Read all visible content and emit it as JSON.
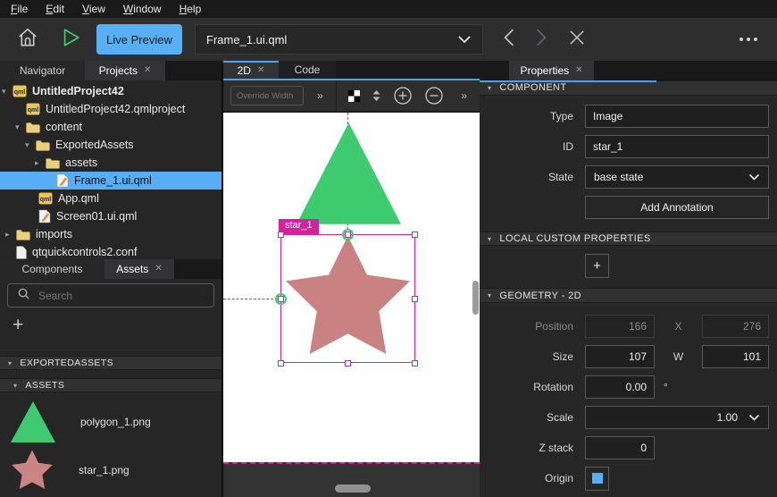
{
  "menubar": {
    "items": [
      "File",
      "Edit",
      "View",
      "Window",
      "Help"
    ]
  },
  "toolbar": {
    "live_preview_label": "Live Preview",
    "open_file": "Frame_1.ui.qml"
  },
  "left_panel": {
    "tabs_top": {
      "navigator": "Navigator",
      "projects": "Projects"
    },
    "project_tree": [
      "UntitledProject42",
      "UntitledProject42.qmlproject",
      "content",
      "ExportedAssets",
      "assets",
      "Frame_1.ui.qml",
      "App.qml",
      "Screen01.ui.qml",
      "imports",
      "qtquickcontrols2.conf"
    ],
    "tabs_bottom": {
      "components": "Components",
      "assets": "Assets"
    },
    "search_placeholder": "Search",
    "sections": {
      "exported_assets": "EXPORTEDASSETS",
      "assets": "ASSETS"
    },
    "asset_files": [
      "polygon_1.png",
      "star_1.png"
    ]
  },
  "canvas_panel": {
    "tabs": {
      "tab_2d": "2D",
      "tab_code": "Code"
    },
    "override_width_placeholder": "Override Width",
    "selection_label": "star_1"
  },
  "properties_panel": {
    "tab": "Properties",
    "component": {
      "title": "COMPONENT",
      "type_label": "Type",
      "type_value": "Image",
      "id_label": "ID",
      "id_value": "star_1",
      "state_label": "State",
      "state_value": "base state",
      "add_annotation": "Add Annotation"
    },
    "local_custom": {
      "title": "LOCAL CUSTOM PROPERTIES"
    },
    "geometry": {
      "title": "GEOMETRY - 2D",
      "position_label": "Position",
      "position_x": "166",
      "position_sep": "X",
      "position_y": "276",
      "size_label": "Size",
      "size_w": "107",
      "size_sep": "W",
      "size_h": "101",
      "rotation_label": "Rotation",
      "rotation_value": "0.00",
      "rotation_unit": "°",
      "scale_label": "Scale",
      "scale_value": "1.00",
      "zstack_label": "Z stack",
      "zstack_value": "0",
      "origin_label": "Origin"
    }
  },
  "colors": {
    "accent_blue": "#57b0f4",
    "selection_magenta": "#d4219c",
    "shape_green": "#3ecb70",
    "shape_pink": "#ca8181"
  }
}
